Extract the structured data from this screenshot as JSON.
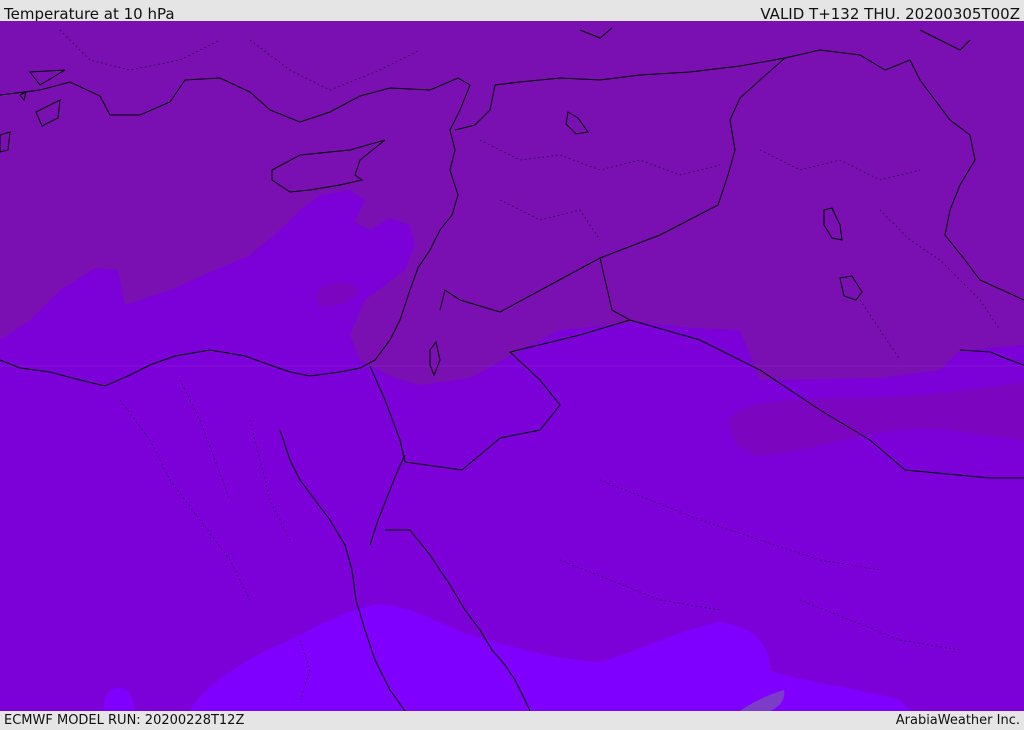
{
  "header": {
    "title": "Temperature at 10 hPa",
    "valid": "VALID T+132 THU. 20200305T00Z"
  },
  "footer": {
    "model_run": "ECMWF MODEL RUN: 20200228T12Z",
    "credit": "ArabiaWeather Inc."
  },
  "colors": {
    "band_darkest": "#7a10b2",
    "band_dark": "#7c06c0",
    "band_mid": "#7c00d8",
    "band_light": "#8000ff",
    "band_accent": "#7c3cc8",
    "border_line": "#000000",
    "bar_background": "#e5e5e5"
  }
}
